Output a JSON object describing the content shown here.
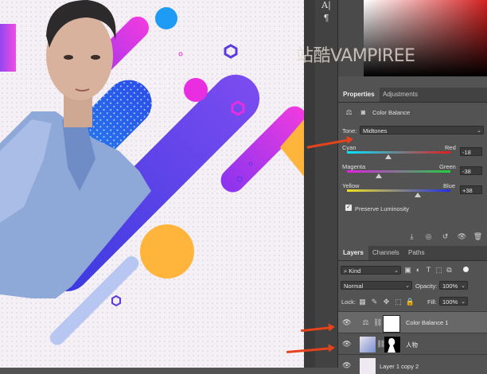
{
  "tools": {
    "type_tool_glyph": "A|",
    "paragraph_glyph": "¶"
  },
  "watermark": "站酷VAMPIREE",
  "properties": {
    "tabs": [
      {
        "label": "Properties"
      },
      {
        "label": "Adjustments"
      }
    ],
    "adjustment_name": "Color Balance",
    "tone_label": "Tone:",
    "tone_value": "Midtones",
    "sliders": [
      {
        "left": "Cyan",
        "right": "Red",
        "value": "-18",
        "level": -18
      },
      {
        "left": "Magenta",
        "right": "Green",
        "value": "-38",
        "level": -38
      },
      {
        "left": "Yellow",
        "right": "Blue",
        "value": "+38",
        "level": 38
      }
    ],
    "preserve_luminosity_label": "Preserve Luminosity",
    "preserve_luminosity_checked": true
  },
  "layers_panel": {
    "tabs": [
      {
        "label": "Layers"
      },
      {
        "label": "Channels"
      },
      {
        "label": "Paths"
      }
    ],
    "filter_kind": "Kind",
    "blend_mode": "Normal",
    "opacity_label": "Opacity:",
    "opacity_value": "100%",
    "lock_label": "Lock:",
    "fill_label": "Fill:",
    "fill_value": "100%",
    "layers": [
      {
        "name": "Color Balance 1",
        "selected": true
      },
      {
        "name": "人物",
        "selected": false
      },
      {
        "name": "Layer 1 copy 2",
        "selected": false
      }
    ]
  },
  "colors": {
    "accent_arrow": "#e4431c",
    "panel_bg": "#535353",
    "selected_row": "#686868"
  }
}
